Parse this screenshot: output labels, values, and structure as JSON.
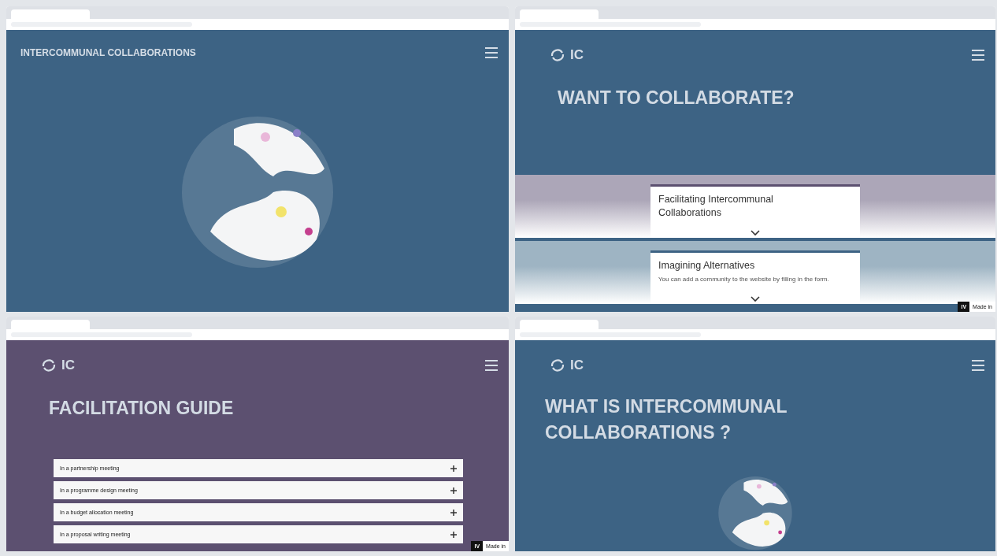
{
  "windows": [
    {
      "kind": "globe",
      "site_title": "INTERCOMMUNAL COLLABORATIONS"
    },
    {
      "kind": "cards",
      "logo": "IC",
      "heading": "WANT TO COLLABORATE?",
      "cards": [
        {
          "title": "Facilitating Intercommunal Collaborations"
        },
        {
          "title": "Imagining Alternatives",
          "text": "You can add a community to the website by filling in the form."
        }
      ],
      "badge_logo": "IV",
      "badge": "Made in"
    },
    {
      "kind": "accordion",
      "logo": "IC",
      "heading": "FACILITATION GUIDE",
      "items": [
        {
          "label": "In a partnership meeting",
          "expanded": false
        },
        {
          "label": "In a programme design meeting",
          "expanded": false
        },
        {
          "label": "In a budget allocation meeting",
          "expanded": false
        },
        {
          "label": "In a proposal writing meeting",
          "expanded": false
        }
      ],
      "badge_logo": "IV",
      "badge": "Made in"
    },
    {
      "kind": "globe_heading",
      "logo": "IC",
      "heading": "WHAT IS INTERCOMMUNAL COLLABORATIONS ?"
    }
  ]
}
